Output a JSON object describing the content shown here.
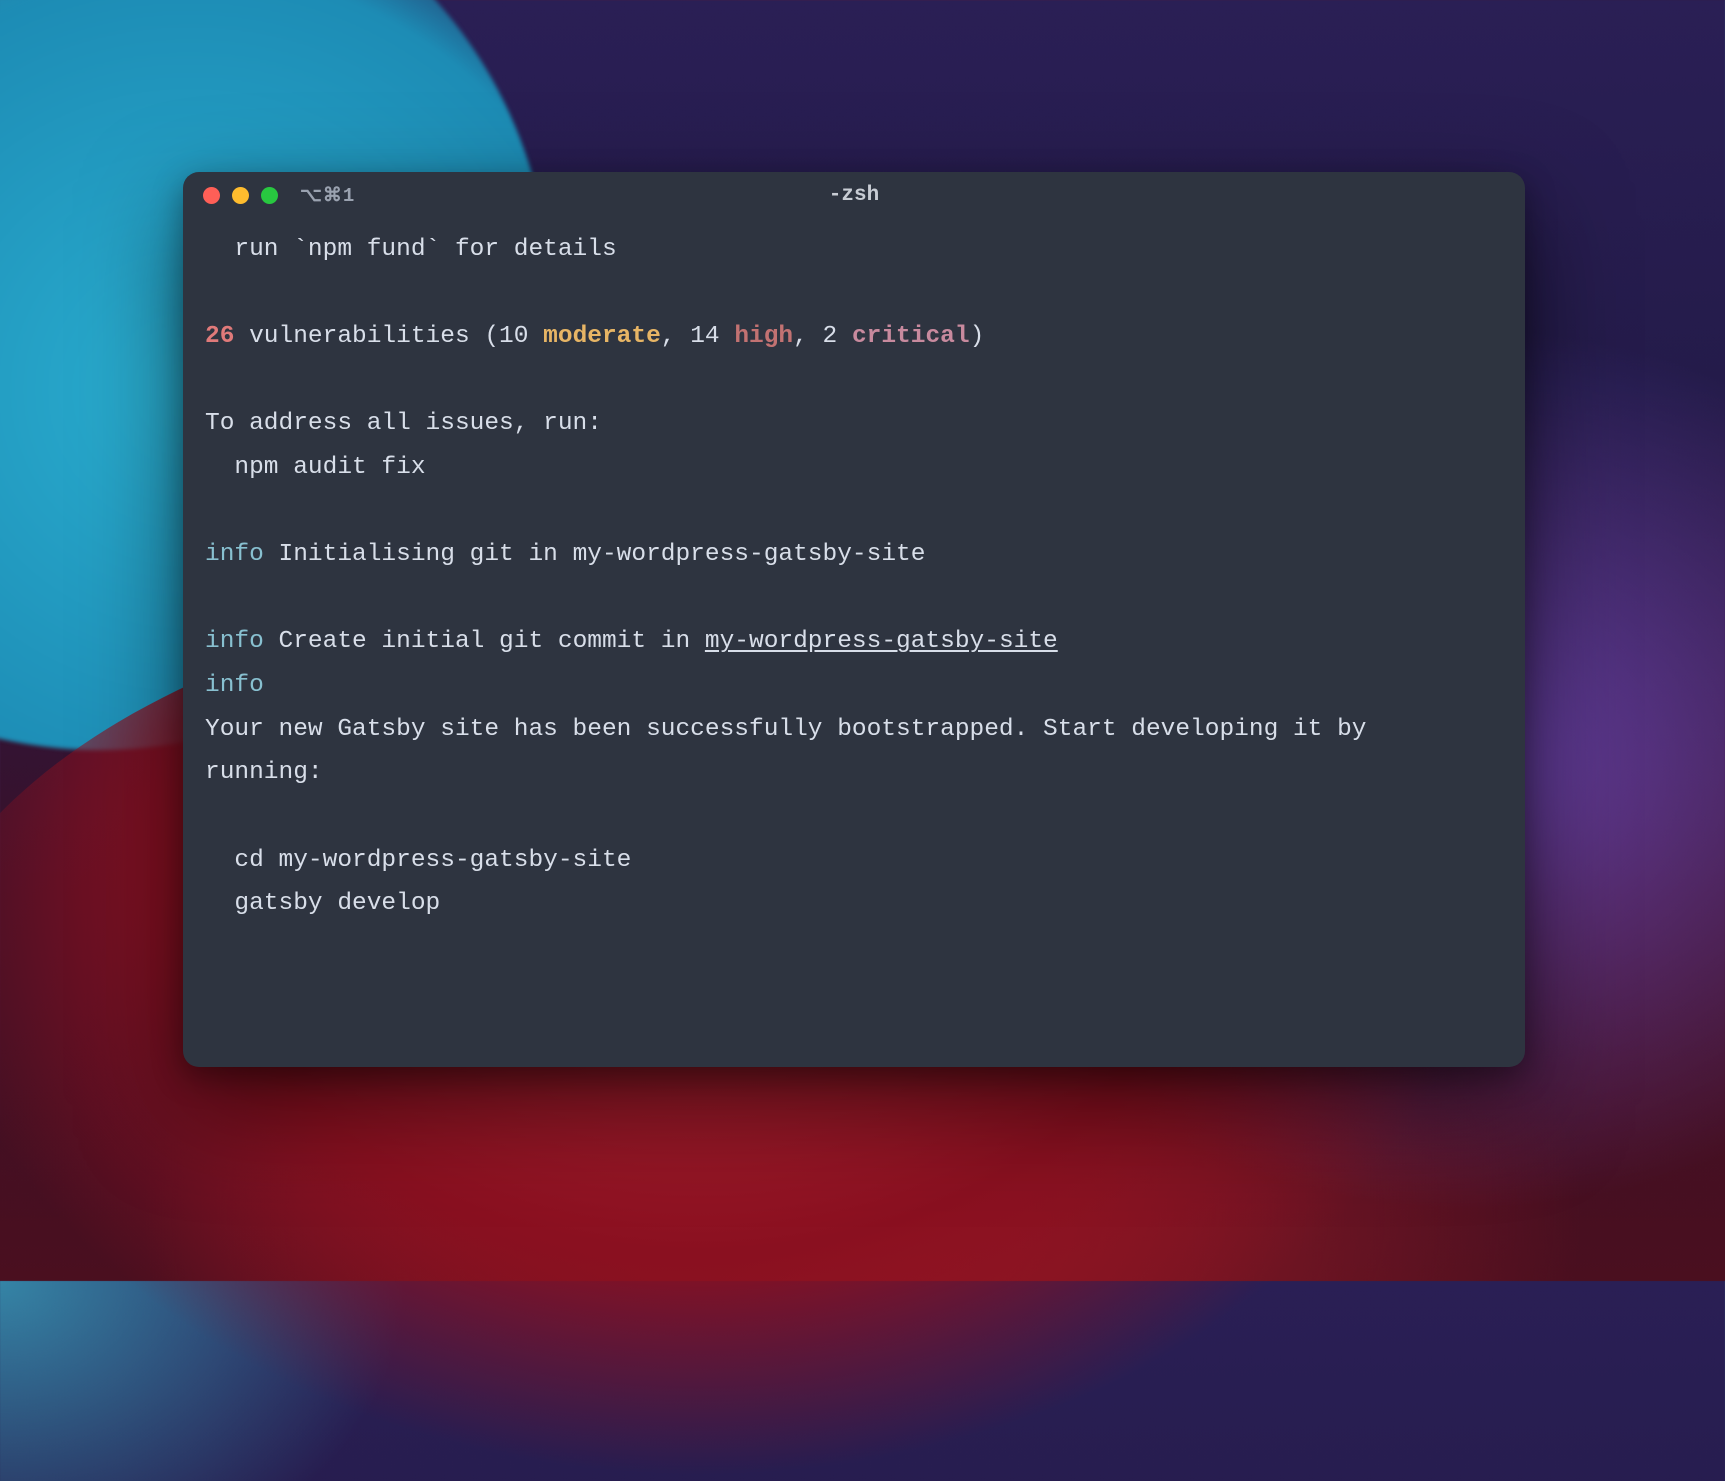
{
  "window": {
    "tab_label": "⌥⌘1",
    "title": "-zsh"
  },
  "term": {
    "l1": "  run `npm fund` for details",
    "l2": "",
    "vuln": {
      "count": "26",
      "word": " vulnerabilities (10 ",
      "moderate": "moderate",
      "sep1": ", 14 ",
      "high": "high",
      "sep2": ", 2 ",
      "critical": "critical",
      "close": ")"
    },
    "l4": "",
    "l5": "To address all issues, run:",
    "l6": "  npm audit fix",
    "l7": "",
    "info1": {
      "label": "info",
      "text": " Initialising git in my-wordpress-gatsby-site"
    },
    "l9": "",
    "info2": {
      "label": "info",
      "text_a": " Create initial git commit in ",
      "link": "my-wordpress-gatsby-site"
    },
    "info3": {
      "label": "info"
    },
    "l12": "Your new Gatsby site has been successfully bootstrapped. Start developing it by",
    "l13": "running:",
    "l14": "",
    "l15": "  cd my-wordpress-gatsby-site",
    "l16": "  gatsby develop"
  }
}
